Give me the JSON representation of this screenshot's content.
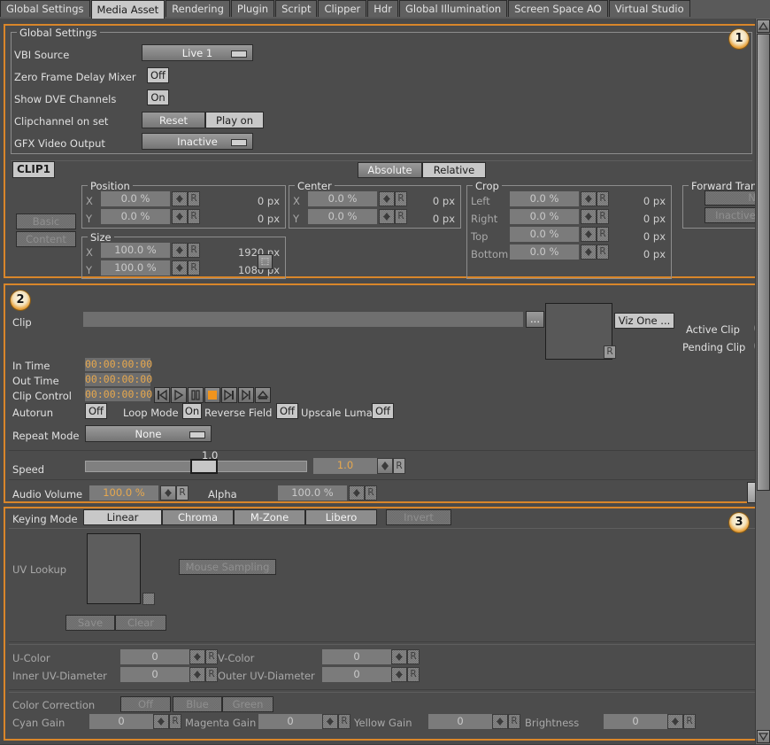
{
  "window": {
    "tabs": [
      {
        "label": "Global Settings",
        "selected": false
      },
      {
        "label": "Media Asset",
        "selected": true
      },
      {
        "label": "Rendering",
        "selected": false
      },
      {
        "label": "Plugin",
        "selected": false
      },
      {
        "label": "Script",
        "selected": false
      },
      {
        "label": "Clipper",
        "selected": false
      },
      {
        "label": "Hdr",
        "selected": false
      },
      {
        "label": "Global Illumination",
        "selected": false
      },
      {
        "label": "Screen Space AO",
        "selected": false
      },
      {
        "label": "Virtual Studio",
        "selected": false
      }
    ],
    "accent_color": "#d9862a",
    "background_color": "#4c4c4c"
  },
  "panel1": {
    "badge": "1",
    "group_title": "Global Settings",
    "rows": {
      "vbi_source": {
        "label": "VBI Source",
        "value": "Live 1"
      },
      "zero_frame_delay_mixer": {
        "label": "Zero Frame Delay Mixer",
        "value": "Off"
      },
      "show_dve_channels": {
        "label": "Show DVE Channels",
        "value": "On"
      },
      "clipchannel_on_set": {
        "label": "Clipchannel on set",
        "reset": "Reset",
        "play_on": "Play on"
      },
      "gfx_video_output": {
        "label": "GFX Video Output",
        "value": "Inactive"
      }
    },
    "clip_tab": "CLIP1",
    "side_buttons": [
      {
        "label": "Basic",
        "enabled": false
      },
      {
        "label": "Content",
        "enabled": false
      }
    ],
    "mode_buttons": [
      {
        "label": "Absolute",
        "selected": false
      },
      {
        "label": "Relative",
        "selected": true
      }
    ],
    "position": {
      "title": "Position",
      "rows": [
        {
          "axis": "X",
          "value": "0.0 %",
          "px": "0 px"
        },
        {
          "axis": "Y",
          "value": "0.0 %",
          "px": "0 px"
        }
      ]
    },
    "size": {
      "title": "Size",
      "rows": [
        {
          "axis": "X",
          "value": "100.0 %",
          "px": "1920 px"
        },
        {
          "axis": "Y",
          "value": "100.0 %",
          "px": "1080 px"
        }
      ]
    },
    "center": {
      "title": "Center",
      "rows": [
        {
          "axis": "X",
          "value": "0.0 %",
          "px": "0 px"
        },
        {
          "axis": "Y",
          "value": "0.0 %",
          "px": "0 px"
        }
      ]
    },
    "crop": {
      "title": "Crop",
      "rows": [
        {
          "axis": "Left",
          "value": "0.0 %",
          "px": "0 px"
        },
        {
          "axis": "Right",
          "value": "0.0 %",
          "px": "0 px"
        },
        {
          "axis": "Top",
          "value": "0.0 %",
          "px": "0 px"
        },
        {
          "axis": "Bottom",
          "value": "0.0 %",
          "px": "0 px"
        }
      ]
    },
    "forward_transform": {
      "title": "Forward Tran",
      "buttons": [
        {
          "label": "No",
          "enabled": false
        },
        {
          "label": "Inactive",
          "enabled": false
        }
      ]
    }
  },
  "panel2": {
    "badge": "2",
    "clip": {
      "label": "Clip",
      "value": "",
      "browse": "..."
    },
    "viz_one_button": "Viz One ...",
    "active_clip_label": "Active Clip",
    "pending_clip_label": "Pending Clip",
    "in_time": {
      "label": "In Time",
      "value": "00:00:00:00"
    },
    "out_time": {
      "label": "Out Time",
      "value": "00:00:00:00"
    },
    "clip_control": {
      "label": "Clip Control",
      "value": "00:00:00:00"
    },
    "transport": [
      {
        "name": "skip-to-start-icon"
      },
      {
        "name": "play-icon"
      },
      {
        "name": "pause-icon"
      },
      {
        "name": "stop-icon"
      },
      {
        "name": "skip-to-end-icon"
      },
      {
        "name": "step-forward-icon"
      },
      {
        "name": "eject-icon"
      }
    ],
    "autorun": {
      "label": "Autorun",
      "value": "Off"
    },
    "loop_mode": {
      "label": "Loop Mode",
      "value": "On"
    },
    "reverse_field": {
      "label": "Reverse Field",
      "value": "Off"
    },
    "upscale_luma": {
      "label": "Upscale Luma",
      "value": "Off"
    },
    "repeat_mode": {
      "label": "Repeat Mode",
      "value": "None"
    },
    "speed": {
      "label": "Speed",
      "slider_label": "1.0",
      "value": "1.0"
    },
    "audio_volume": {
      "label": "Audio Volume",
      "value": "100.0 %"
    },
    "alpha": {
      "label": "Alpha",
      "value": "100.0 %"
    }
  },
  "panel3": {
    "badge": "3",
    "keying_mode": {
      "label": "Keying Mode",
      "modes": [
        {
          "label": "Linear",
          "selected": true
        },
        {
          "label": "Chroma",
          "selected": false
        },
        {
          "label": "M-Zone",
          "selected": false
        },
        {
          "label": "Libero",
          "selected": false
        }
      ],
      "invert": {
        "label": "Invert",
        "enabled": false
      }
    },
    "uv_lookup": {
      "label": "UV Lookup"
    },
    "mouse_sampling": {
      "label": "Mouse Sampling",
      "enabled": false
    },
    "save": {
      "label": "Save",
      "enabled": false
    },
    "clear": {
      "label": "Clear",
      "enabled": false
    },
    "uv_fields": [
      {
        "label": "U-Color",
        "value": "0"
      },
      {
        "label": "V-Color",
        "value": "0"
      },
      {
        "label": "Inner UV-Diameter",
        "value": "0"
      },
      {
        "label": "Outer UV-Diameter",
        "value": "0"
      }
    ],
    "color_correction": {
      "label": "Color Correction",
      "buttons": [
        {
          "label": "Off",
          "enabled": false
        },
        {
          "label": "Blue",
          "enabled": false
        },
        {
          "label": "Green",
          "enabled": false
        }
      ]
    },
    "gains": [
      {
        "label": "Cyan Gain",
        "value": "0"
      },
      {
        "label": "Magenta Gain",
        "value": "0"
      },
      {
        "label": "Yellow Gain",
        "value": "0"
      },
      {
        "label": "Brightness",
        "value": "0"
      }
    ]
  },
  "scrollbar": {
    "up_arrow": "▲",
    "down_arrow": "▼"
  }
}
